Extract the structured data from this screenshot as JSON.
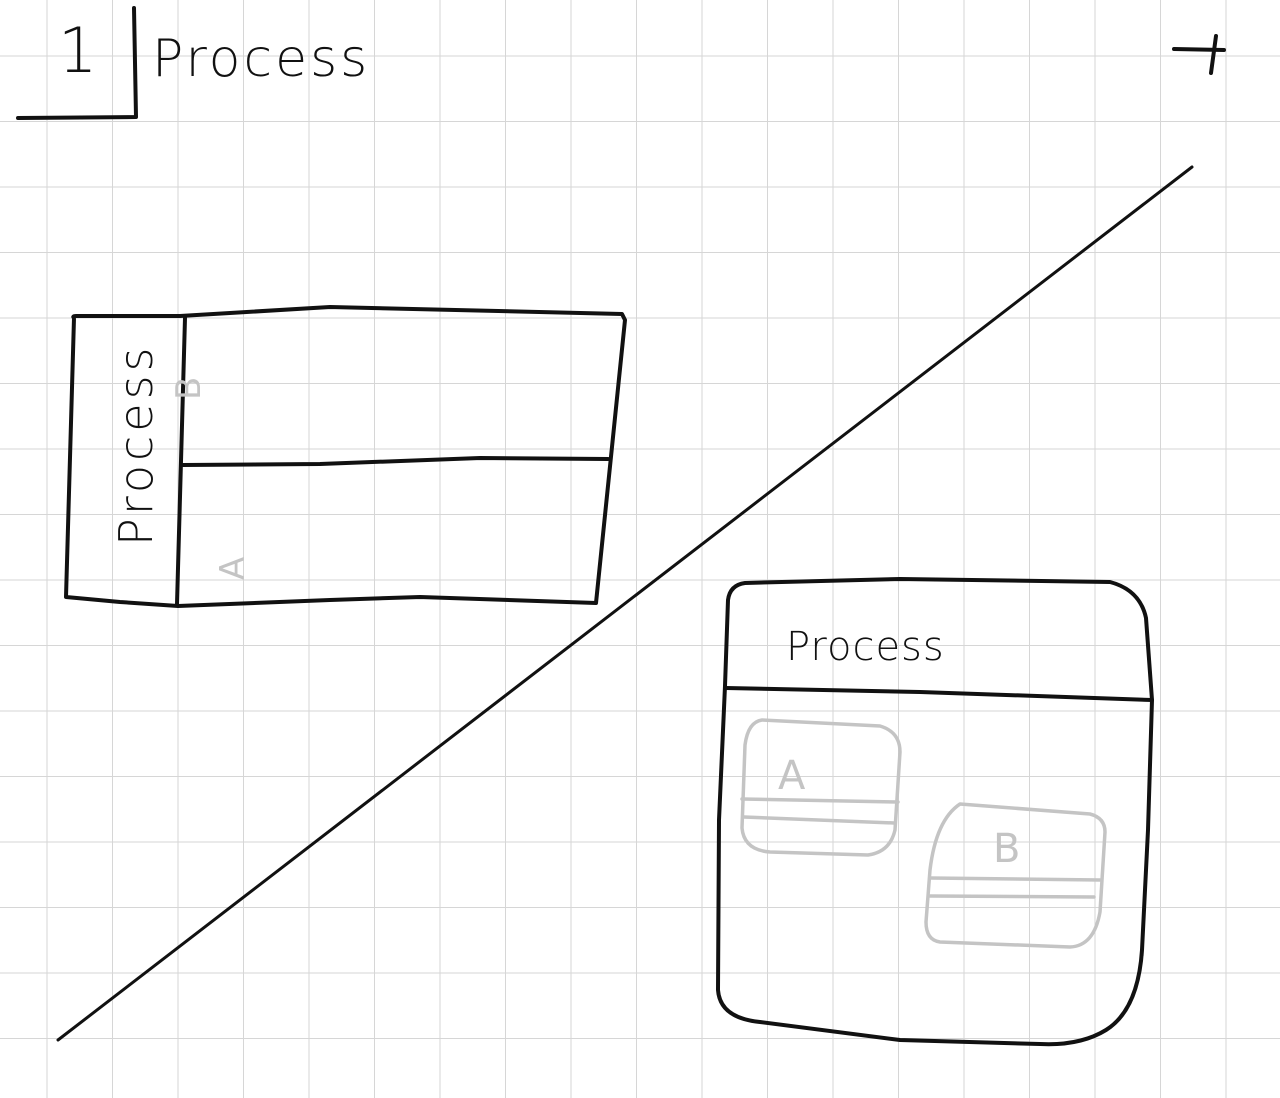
{
  "header": {
    "page_number": "1",
    "title": "Process"
  },
  "horizontal_pool": {
    "label": "Process",
    "lanes": [
      {
        "label": "B"
      },
      {
        "label": "A"
      }
    ]
  },
  "vertical_pool": {
    "label": "Process",
    "boxes": [
      {
        "label": "A"
      },
      {
        "label": "B"
      }
    ]
  },
  "colors": {
    "ink": "#111111",
    "ghost_ink": "#c4c4c4",
    "grid": "#d6d6d6",
    "paper": "#ffffff"
  }
}
